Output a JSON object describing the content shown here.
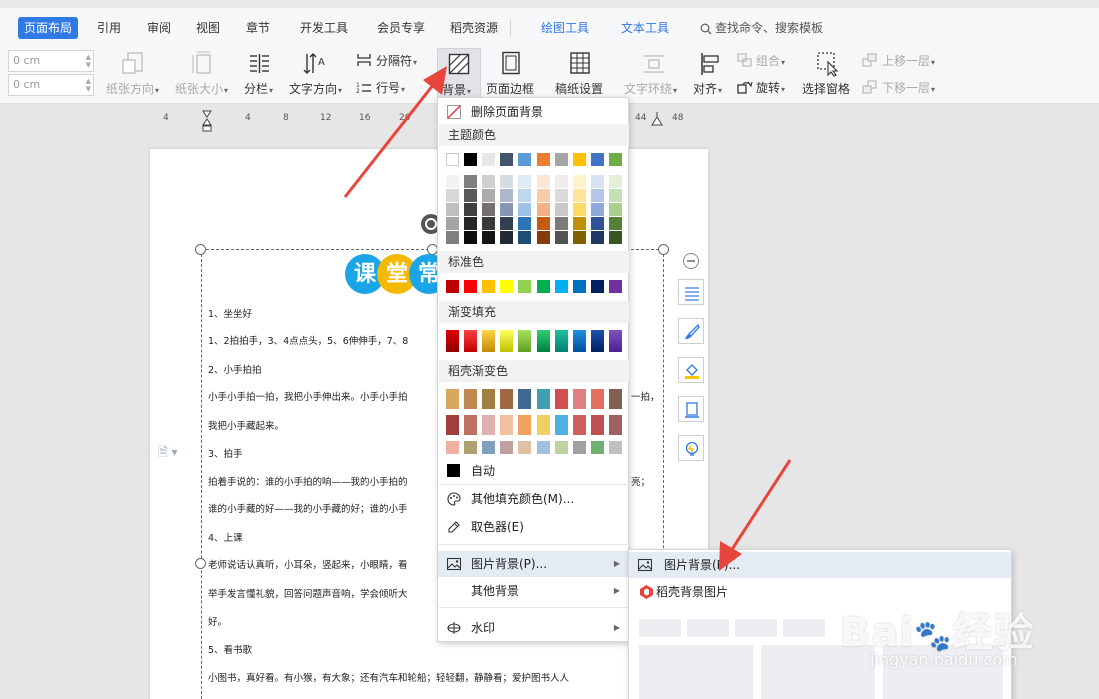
{
  "tabs": [
    {
      "label": "页面布局",
      "active": true
    },
    {
      "label": "引用"
    },
    {
      "label": "审阅"
    },
    {
      "label": "视图"
    },
    {
      "label": "章节"
    },
    {
      "label": "开发工具"
    },
    {
      "label": "会员专享"
    },
    {
      "label": "稻壳资源"
    },
    {
      "label": "绘图工具",
      "context": true
    },
    {
      "label": "文本工具",
      "context": true
    }
  ],
  "search": {
    "label": "查找命令、搜索模板",
    "icon": "search-icon"
  },
  "toolbar": {
    "spin1": "0 cm",
    "spin2": "0 cm",
    "paper_direction": "纸张方向",
    "paper_size": "纸张大小",
    "columns": "分栏",
    "text_direction": "文字方向",
    "separator": "分隔符",
    "line_number": "行号",
    "background": "背景",
    "page_border": "页面边框",
    "manuscript": "稿纸设置",
    "text_wrap": "文字环绕",
    "align": "对齐",
    "group": "组合",
    "rotate": "旋转",
    "select_pane": "选择窗格",
    "bring_forward": "上移一层",
    "send_backward": "下移一层"
  },
  "ruler": [
    "4",
    "4",
    "8",
    "12",
    "16",
    "20",
    "44",
    "48"
  ],
  "document": {
    "title_chars": [
      "课",
      "堂",
      "常"
    ],
    "lines": [
      "1、坐坐好",
      "1、2拍拍手，3、4点点头，5、6伸伸手，7、8",
      "2、小手拍拍",
      "小手小手拍一拍，我把小手伸出来。小手小手拍",
      "我把小手藏起来。",
      "3、拍手",
      "拍着手说的：谁的小手拍的响——我的小手拍的",
      "谁的小手藏的好——我的小手藏的好；谁的小手",
      "4、上课",
      "老师说话认真听，小耳朵，竖起来，小眼睛，看",
      "举手发言懂礼貌，回答问题声音响，学会倾听大",
      "好。",
      "5、看书歌",
      "小图书，真好看。有小猴，有大象；还有汽车和轮船；轻轻翻，静静看；爱护图书人人"
    ],
    "right_fragments": [
      "一拍，",
      "亮；"
    ]
  },
  "menu": {
    "delete_bg": "删除页面背景",
    "theme_colors": "主题颜色",
    "standard_colors": "标准色",
    "gradient_fill": "渐变填充",
    "docer_gradient": "稻壳渐变色",
    "auto": "自动",
    "more_fill": "其他填充颜色(M)...",
    "eyedropper": "取色器(E)",
    "picture_bg": "图片背景(P)...",
    "other_bg": "其他背景",
    "watermark": "水印"
  },
  "submenu": {
    "picture_bg": "图片背景(P)...",
    "docer_bg_pic": "稻壳背景图片"
  },
  "colors": {
    "theme_top": [
      "#ffffff",
      "#000000",
      "#e7e6e6",
      "#44546a",
      "#5b9bd5",
      "#ed7d31",
      "#a5a5a5",
      "#ffc000",
      "#4472c4",
      "#70ad47"
    ],
    "theme_shades": [
      [
        "#f2f2f2",
        "#7f7f7f",
        "#d0cece",
        "#d6dce4",
        "#deebf6",
        "#fbe5d5",
        "#ededed",
        "#fff2cc",
        "#d9e2f3",
        "#e2efd9"
      ],
      [
        "#d8d8d8",
        "#595959",
        "#aeabab",
        "#adb9ca",
        "#bdd7ee",
        "#f7cbac",
        "#dbdbdb",
        "#fee599",
        "#b4c6e7",
        "#c5e0b3"
      ],
      [
        "#bfbfbf",
        "#3f3f3f",
        "#757070",
        "#8496b0",
        "#9cc3e5",
        "#f4b183",
        "#c9c9c9",
        "#ffd965",
        "#8eaadb",
        "#a8d08d"
      ],
      [
        "#a5a5a5",
        "#262626",
        "#3a3838",
        "#323f4f",
        "#2e75b5",
        "#c55a11",
        "#7b7b7b",
        "#bf9000",
        "#2f5496",
        "#538135"
      ],
      [
        "#7f7f7f",
        "#0c0c0c",
        "#171616",
        "#222a35",
        "#1e4e79",
        "#843c0b",
        "#525252",
        "#7f6000",
        "#1f3864",
        "#375623"
      ]
    ],
    "standard": [
      "#c00000",
      "#ff0000",
      "#ffc000",
      "#ffff00",
      "#92d050",
      "#00b050",
      "#00b0f0",
      "#0070c0",
      "#002060",
      "#7030a0"
    ],
    "gradient": [
      [
        "#e00000",
        "#900000"
      ],
      [
        "#ff4040",
        "#c00000"
      ],
      [
        "#ffd54a",
        "#c08a00"
      ],
      [
        "#ffff60",
        "#c0c000"
      ],
      [
        "#a8e060",
        "#60a020"
      ],
      [
        "#30d070",
        "#008040"
      ],
      [
        "#20c0a0",
        "#008070"
      ],
      [
        "#2090e0",
        "#0050a0"
      ],
      [
        "#2050b0",
        "#002060"
      ],
      [
        "#8050c0",
        "#502090"
      ]
    ],
    "docer": [
      [
        "#d8a860",
        "#c08850",
        "#a08040",
        "#a06840",
        "#406890",
        "#40a0b0",
        "#d05050",
        "#e08080",
        "#e07060",
        "#806050"
      ],
      [
        "#a04040",
        "#c07060",
        "#e0b0b0",
        "#f0c0a0",
        "#f0a060",
        "#f0d060",
        "#50b0e0",
        "#d06060",
        "#c05050",
        "#a06060"
      ],
      [
        "#f0b0a0",
        "#b0a070",
        "#80a0c0",
        "#c0a0a0",
        "#e0c0a0",
        "#a0c0e0",
        "#c0d0a0",
        "#a0a0a0",
        "#70b070",
        "#c0c0c0"
      ]
    ],
    "accent": "#2f7ae5",
    "arrow": "#e8453c"
  }
}
